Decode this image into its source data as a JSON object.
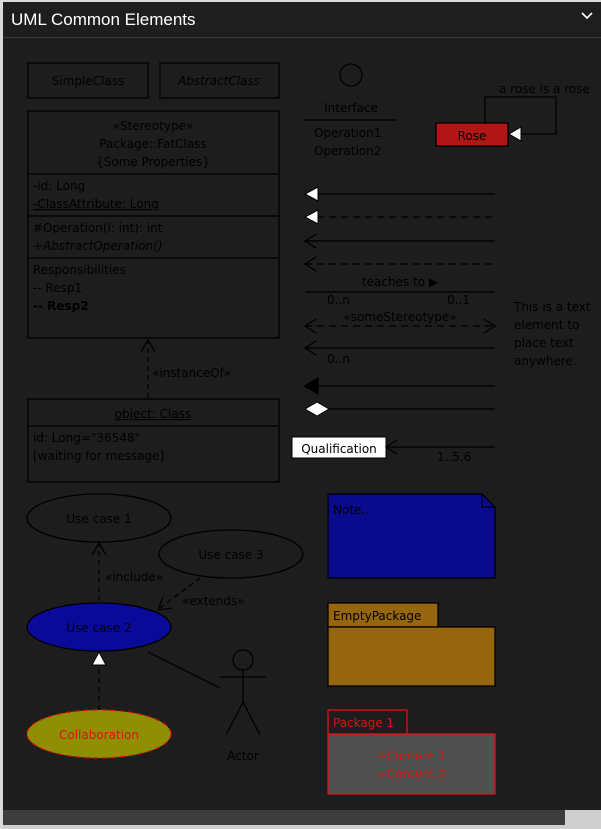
{
  "header": {
    "title": "UML Common Elements"
  },
  "classes": {
    "simple": "SimpleClass",
    "abstract": "AbstractClass",
    "fat": {
      "stereotype": "«Stereotype»",
      "name": "Package::FatClass",
      "properties": "{Some Properties}",
      "attr1": "-id: Long",
      "attr2": "-ClassAttribute: Long",
      "op1": "#Operation(i: int): int",
      "op2": "+AbstractOperation()",
      "resp_title": "Responsibilities",
      "resp1": "-- Resp1",
      "resp2": "-- Resp2"
    },
    "object": {
      "name": "object: Class",
      "line1": "id: Long=\"36548\"",
      "line2": "[waiting for message]"
    }
  },
  "interface": {
    "name": "Interface",
    "op1": "Operation1",
    "op2": "Operation2"
  },
  "rose": {
    "label": "Rose",
    "self_note": "a rose is a rose"
  },
  "relations": {
    "instance_of": "«instanceOf»",
    "teaches": "teaches to ▶",
    "mult_left": "0..n",
    "mult_right": "0..1",
    "some_stereotype": "«someStereotype»",
    "mult_bottom": "0..n",
    "qualification": "Qualification",
    "qual_mult": "1..5,6"
  },
  "free_text": {
    "line1": "This is a text",
    "line2": "element to",
    "line3": "place text",
    "line4": "anywhere."
  },
  "use_cases": {
    "uc1": "Use case 1",
    "uc2": "Use case 2",
    "uc3": "Use case 3",
    "include": "«include»",
    "extends": "«extends»",
    "collaboration": "Collaboration",
    "actor": "Actor"
  },
  "note": {
    "label": "Note.."
  },
  "packages": {
    "empty": "EmptyPackage",
    "pkg1": "Package 1",
    "content1": "+Content 1",
    "content2": "+Content 2"
  },
  "colors": {
    "background": "#1d1d1d",
    "rose": "#b01616",
    "note": "#0a0a8c",
    "package": "#96660f",
    "uc2": "#0a0a9a",
    "collaboration": "#8f8f06",
    "package1_border": "#e01010"
  }
}
